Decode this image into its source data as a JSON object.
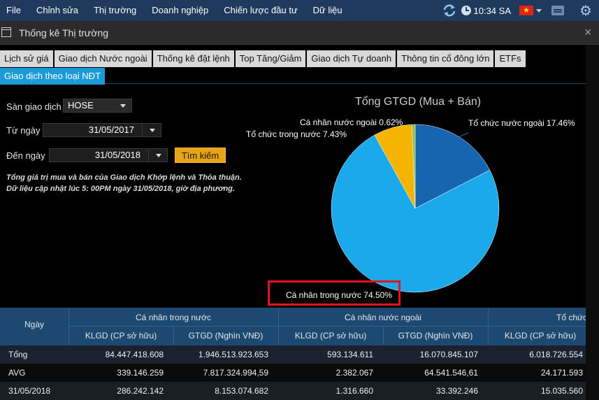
{
  "menubar": {
    "items": [
      "File",
      "Chỉnh sửa",
      "Thị trường",
      "Doanh nghiệp",
      "Chiến lược đầu tư",
      "Dữ liệu"
    ],
    "time": "10:34 SA"
  },
  "window": {
    "title": "Thống kê Thị trường"
  },
  "tabs": {
    "row1": [
      "Lịch sử giá",
      "Giao dịch Nước ngoài",
      "Thống kê đặt lệnh",
      "Top Tăng/Giảm",
      "Giao dịch Tự doanh",
      "Thông tin cổ đông lớn",
      "ETFs"
    ],
    "row2": [
      "Giao dịch theo loại NĐT"
    ],
    "active": "Giao dịch theo loại NĐT"
  },
  "form": {
    "exchange_label": "Sàn giao dịch",
    "exchange_value": "HOSE",
    "from_label": "Từ ngày",
    "from_value": "31/05/2017",
    "to_label": "Đến ngày",
    "to_value": "31/05/2018",
    "search_label": "Tìm kiếm",
    "note": "Tổng giá trị mua và bán của Giao dịch Khớp lệnh và Thỏa thuận. Dữ liệu cập nhật lúc 5: 00PM ngày 31/05/2018, giờ địa phương."
  },
  "chart_data": {
    "type": "pie",
    "title": "Tổng GTGD (Mua + Bán)",
    "slices": [
      {
        "label": "Cá nhân trong nước",
        "value": 74.5,
        "display": "Cá nhân trong nước 74.50%",
        "color": "#1aa9ea"
      },
      {
        "label": "Tổ chức trong nước",
        "value": 7.43,
        "display": "Tổ chức trong nước 7.43%",
        "color": "#f5b400"
      },
      {
        "label": "Cá nhân nước ngoài",
        "value": 0.62,
        "display": "Cá nhân nước ngoài 0.62%",
        "color": "#8bc34a"
      },
      {
        "label": "Tổ chức nước ngoài",
        "value": 17.46,
        "display": "Tổ chức nước ngoài 17.46%",
        "color": "#1565b0"
      }
    ]
  },
  "table": {
    "date_header": "Ngày",
    "groups": [
      "Cá nhân trong nước",
      "Cá nhân nước ngoài",
      "Tổ chức"
    ],
    "subheaders": [
      "KLGD (CP sở hữu)",
      "GTGD (Nghìn VNĐ)",
      "KLGD (CP sở hữu)",
      "GTGD (Nghìn VNĐ)",
      "KLGD (CP sở hữu)"
    ],
    "rows": [
      {
        "label": "Tổng",
        "values": [
          "84.447.418.608",
          "1.946.513.923.653",
          "593.134.611",
          "16.070.845.107",
          "6.018.726.554"
        ]
      },
      {
        "label": "AVG",
        "values": [
          "339.146.259",
          "7.817.324.994,59",
          "2.382.067",
          "64.541.546,61",
          "24.171.593"
        ]
      },
      {
        "label": "31/05/2018",
        "values": [
          "286.242.142",
          "8.153.074.682",
          "1.316.660",
          "33.392.246",
          "15.035.560"
        ]
      }
    ]
  }
}
